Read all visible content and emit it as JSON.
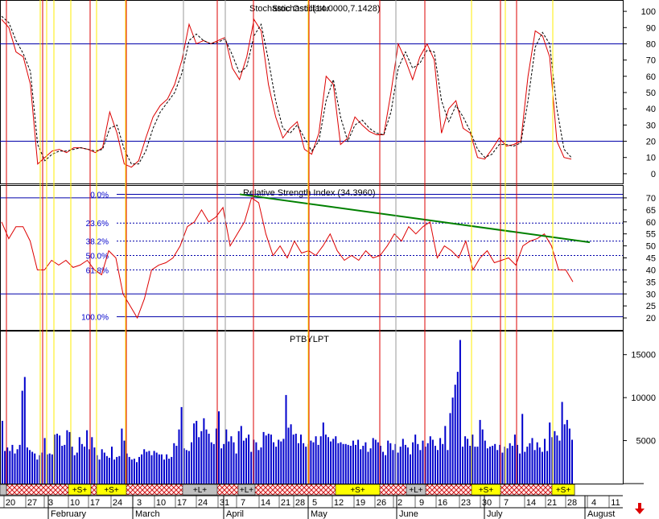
{
  "chart_data": [
    {
      "type": "line",
      "title": "Stochastic Oscillator",
      "title_overlap": "Stochastic(14.0000,7.1428)",
      "ylim": [
        -5,
        105
      ],
      "yticks": [
        0,
        10,
        20,
        30,
        40,
        50,
        60,
        70,
        80,
        90,
        100
      ],
      "reference_lines": [
        20,
        80
      ],
      "series": [
        {
          "name": "%K",
          "color": "#dd0000",
          "values": [
            95,
            90,
            75,
            72,
            55,
            6,
            10,
            14,
            15,
            13,
            16,
            16,
            15,
            13,
            16,
            38,
            25,
            6,
            4,
            8,
            22,
            35,
            42,
            46,
            55,
            70,
            92,
            80,
            82,
            80,
            82,
            84,
            65,
            58,
            72,
            95,
            88,
            55,
            35,
            22,
            28,
            32,
            15,
            12,
            25,
            60,
            55,
            18,
            22,
            35,
            30,
            26,
            24,
            24,
            50,
            80,
            70,
            58,
            72,
            80,
            70,
            25,
            40,
            45,
            28,
            25,
            10,
            9,
            15,
            22,
            17,
            18,
            20,
            60,
            88,
            85,
            72,
            20,
            10,
            9
          ]
        },
        {
          "name": "%D",
          "color": "#000000",
          "dashed": true,
          "values": [
            97,
            93,
            82,
            74,
            63,
            18,
            8,
            12,
            14,
            14,
            15,
            16,
            15,
            14,
            15,
            28,
            30,
            15,
            6,
            6,
            14,
            28,
            38,
            44,
            50,
            62,
            82,
            86,
            82,
            80,
            81,
            83,
            73,
            62,
            66,
            85,
            92,
            70,
            45,
            28,
            25,
            30,
            22,
            14,
            20,
            45,
            58,
            35,
            20,
            30,
            33,
            28,
            25,
            24,
            38,
            65,
            75,
            65,
            68,
            76,
            75,
            45,
            32,
            42,
            35,
            26,
            15,
            10,
            12,
            18,
            18,
            17,
            19,
            45,
            78,
            87,
            80,
            40,
            15,
            10
          ]
        }
      ]
    },
    {
      "type": "line",
      "title": "Relative Strength Index (34.3960)",
      "ylim": [
        15,
        75
      ],
      "yticks": [
        20,
        25,
        30,
        35,
        40,
        45,
        50,
        55,
        60,
        65,
        70
      ],
      "fibonacci_levels": [
        {
          "label": "0.0%",
          "value": 71.5
        },
        {
          "label": "23.6%",
          "value": 59.5
        },
        {
          "label": "38.2%",
          "value": 52.0
        },
        {
          "label": "50.0%",
          "value": 46.0
        },
        {
          "label": "61.8%",
          "value": 40.0
        },
        {
          "label": "100.0%",
          "value": 20.5
        }
      ],
      "reference_lines": [
        30,
        70
      ],
      "trendline": {
        "x": [
          0,
          1
        ],
        "y": [
          71.5,
          51.5
        ],
        "color": "#008000"
      },
      "series": [
        {
          "name": "RSI",
          "color": "#dd0000",
          "values": [
            60,
            53,
            58,
            58,
            52,
            40,
            40,
            44,
            42,
            44,
            41,
            42,
            44,
            40,
            38,
            48,
            45,
            30,
            25,
            20,
            28,
            40,
            42,
            43,
            45,
            50,
            58,
            60,
            65,
            60,
            62,
            66,
            50,
            55,
            60,
            70,
            68,
            55,
            46,
            50,
            45,
            52,
            47,
            48,
            46,
            50,
            55,
            48,
            44,
            46,
            44,
            48,
            45,
            46,
            50,
            55,
            52,
            58,
            55,
            58,
            60,
            45,
            50,
            48,
            45,
            52,
            40,
            45,
            48,
            43,
            44,
            45,
            42,
            50,
            52,
            53,
            55,
            50,
            40,
            40,
            35
          ]
        }
      ]
    },
    {
      "type": "bar",
      "title": "PTBYLPT",
      "ylim": [
        0,
        17500
      ],
      "yticks": [
        5000,
        10000,
        15000
      ],
      "color": "#0000cc",
      "values": [
        7300,
        3800,
        4200,
        3800,
        4500,
        3500,
        4000,
        4500,
        10800,
        12400,
        4200,
        3900,
        3700,
        3500,
        2800,
        3300,
        3600,
        5300,
        3400,
        3500,
        3400,
        5700,
        5800,
        5600,
        4400,
        4500,
        6200,
        6000,
        4300,
        3300,
        3600,
        5400,
        4600,
        4300,
        6200,
        4000,
        5400,
        4200,
        3300,
        2800,
        4000,
        3600,
        3200,
        3000,
        4300,
        2800,
        3100,
        3200,
        6400,
        5000,
        3500,
        3100,
        2800,
        2900,
        2500,
        3100,
        3400,
        4000,
        3700,
        3800,
        3300,
        3800,
        3600,
        3400,
        3400,
        2800,
        3400,
        2900,
        3100,
        4700,
        4400,
        6300,
        8900,
        4100,
        3900,
        3800,
        4800,
        7000,
        7300,
        5400,
        6100,
        7600,
        6300,
        5800,
        4800,
        4600,
        6400,
        8400,
        4100,
        4600,
        6300,
        4900,
        5500,
        4800,
        3500,
        6100,
        6700,
        5000,
        5300,
        5700,
        3700,
        5100,
        4800,
        3900,
        4200,
        6000,
        5600,
        5800,
        5700,
        4800,
        4300,
        5100,
        4900,
        5200,
        10300,
        6500,
        6900,
        5700,
        5800,
        4700,
        5700,
        4700,
        4300,
        4600,
        5000,
        4800,
        5500,
        4500,
        5500,
        7100,
        5700,
        5400,
        4900,
        5200,
        5500,
        4700,
        4800,
        4600,
        4600,
        4500,
        4400,
        5000,
        4500,
        5100,
        4000,
        4400,
        4800,
        3700,
        4100,
        5300,
        5100,
        4800,
        4400,
        3700,
        3300,
        5000,
        4700,
        3900,
        4600,
        3600,
        4300,
        5200,
        4500,
        4200,
        3400,
        4800,
        5700,
        4600,
        3900,
        5000,
        4300,
        4700,
        5500,
        5100,
        4400,
        3900,
        5300,
        4600,
        6700,
        3900,
        8200,
        10000,
        11500,
        13000,
        16700,
        4300,
        5500,
        5200,
        4400,
        5700,
        4300,
        4300,
        7400,
        6300,
        5000,
        4100,
        4300,
        4400,
        4600,
        3900,
        4500,
        3600,
        4300,
        4100,
        4700,
        4400,
        5700,
        4500,
        3500,
        8100,
        3700,
        4300,
        4700,
        5300,
        3900,
        4800,
        4200,
        3700,
        5200,
        3800,
        7100,
        5400,
        6100,
        5600,
        5000,
        9500,
        6900,
        7400,
        6400,
        5100
      ]
    }
  ],
  "time_axis": {
    "day_labels": [
      "20",
      "27",
      "3",
      "10",
      "17",
      "24",
      "3",
      "10",
      "17",
      "24",
      "31",
      "7",
      "14",
      "21",
      "28",
      "5",
      "12",
      "19",
      "26",
      "2",
      "9",
      "16",
      "23",
      "30",
      "7",
      "14",
      "21",
      "28",
      "4",
      "11"
    ],
    "month_labels": [
      "February",
      "March",
      "April",
      "May",
      "June",
      "July",
      "August"
    ]
  },
  "signal_band": [
    {
      "text": "+S+",
      "style": "yellow"
    },
    {
      "text": "+S+",
      "style": "yellow"
    },
    {
      "text": "+L+",
      "style": "grey"
    },
    {
      "text": "+L+",
      "style": "grey"
    },
    {
      "text": "+S+",
      "style": "yellow"
    },
    {
      "text": "+L+",
      "style": "grey"
    },
    {
      "text": "+S+",
      "style": "yellow"
    },
    {
      "text": "+S+",
      "style": "yellow"
    }
  ],
  "colors": {
    "grid_line": "#0000aa",
    "red_marker": "#dd0000",
    "yellow_marker": "#ffee00",
    "band_red": "#cc0000",
    "band_yellow": "#ffff00"
  },
  "nav": {
    "icon": "down-arrow-icon",
    "color": "#dd0000"
  }
}
